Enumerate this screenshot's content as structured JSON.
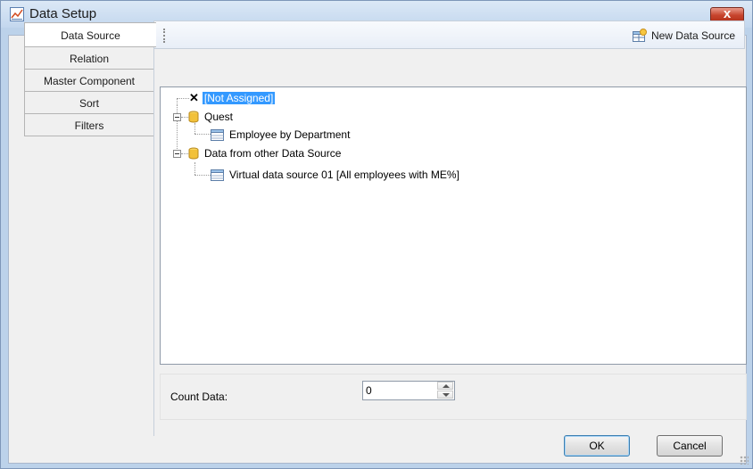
{
  "window": {
    "title": "Data Setup",
    "close_symbol": "x"
  },
  "tabs": [
    {
      "label": "Data Source",
      "active": true
    },
    {
      "label": "Relation",
      "active": false
    },
    {
      "label": "Master Component",
      "active": false
    },
    {
      "label": "Sort",
      "active": false
    },
    {
      "label": "Filters",
      "active": false
    }
  ],
  "toolbar": {
    "new_data_source_label": "New Data Source"
  },
  "tree": {
    "not_assigned": "[Not Assigned]",
    "quest": "Quest",
    "employee_by_department": "Employee by Department",
    "data_from_other": "Data from other Data Source",
    "virtual_source": "Virtual data source 01 [All employees with ME%]"
  },
  "count": {
    "label": "Count Data:",
    "value": "0"
  },
  "buttons": {
    "ok": "OK",
    "cancel": "Cancel"
  },
  "colors": {
    "selection": "#3399ff",
    "close": "#c7432c",
    "title_bar": "#c3d7ee"
  }
}
